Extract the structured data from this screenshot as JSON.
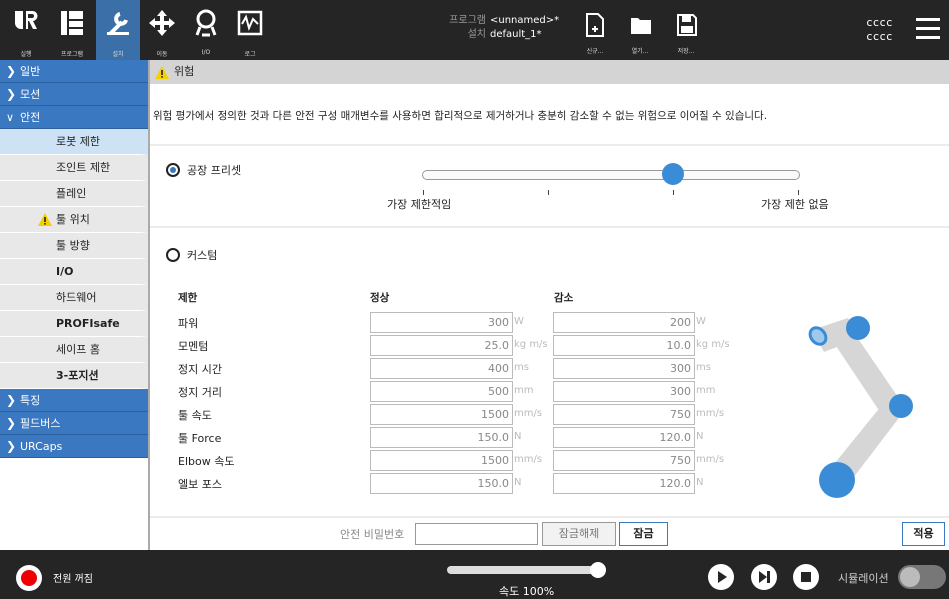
{
  "topbar": {
    "nav": [
      {
        "label": "실행",
        "icon": "ur-logo-icon"
      },
      {
        "label": "프로그램",
        "icon": "program-icon"
      },
      {
        "label": "설치",
        "icon": "installation-icon"
      },
      {
        "label": "이동",
        "icon": "move-icon"
      },
      {
        "label": "I/O",
        "icon": "io-icon"
      },
      {
        "label": "로그",
        "icon": "log-icon"
      }
    ],
    "program_key": "프로그램",
    "program_value": "<unnamed>*",
    "install_key": "설치",
    "install_value": "default_1*",
    "file_buttons": [
      {
        "label": "신규...",
        "icon": "new-file-icon"
      },
      {
        "label": "열기...",
        "icon": "open-folder-icon"
      },
      {
        "label": "저장...",
        "icon": "save-icon"
      }
    ],
    "user_line1": "cccc",
    "user_line2": "cccc",
    "menu_icon": "hamburger-menu-icon"
  },
  "sidebar": {
    "groups": [
      {
        "label": "일반",
        "expanded": false
      },
      {
        "label": "모션",
        "expanded": false
      },
      {
        "label": "안전",
        "expanded": true
      }
    ],
    "safety_items": [
      {
        "label": "로봇 제한",
        "selected": true,
        "bold": false,
        "warning": false
      },
      {
        "label": "조인트 제한",
        "selected": false,
        "bold": false,
        "warning": false
      },
      {
        "label": "플레인",
        "selected": false,
        "bold": false,
        "warning": false
      },
      {
        "label": "툴 위치",
        "selected": false,
        "bold": false,
        "warning": true
      },
      {
        "label": "툴 방향",
        "selected": false,
        "bold": false,
        "warning": false
      },
      {
        "label": "I/O",
        "selected": false,
        "bold": true,
        "warning": false
      },
      {
        "label": "하드웨어",
        "selected": false,
        "bold": false,
        "warning": false
      },
      {
        "label": "PROFIsafe",
        "selected": false,
        "bold": true,
        "warning": false
      },
      {
        "label": "세이프 홈",
        "selected": false,
        "bold": false,
        "warning": false
      },
      {
        "label": "3-포지션",
        "selected": false,
        "bold": true,
        "warning": false
      }
    ],
    "groups_after": [
      {
        "label": "특징"
      },
      {
        "label": "필드버스"
      },
      {
        "label": "URCaps"
      }
    ]
  },
  "main": {
    "header": "위험",
    "description": "위험 평가에서 정의한 것과 다른 안전 구성 매개변수를 사용하면 합리적으로 제거하거나 충분히 감소할 수 없는 위험으로 이어질 수 있습니다.",
    "preset_label": "공장 프리셋",
    "preset_selected": true,
    "slider_level_fraction": 0.66,
    "slider_min_label": "가장 제한적임",
    "slider_max_label": "가장 제한 없음",
    "custom_label": "커스텀",
    "custom_selected": false,
    "col_limit": "제한",
    "col_normal": "정상",
    "col_reduced": "감소",
    "rows": [
      {
        "label": "파워",
        "normal": "300",
        "normal_unit": "W",
        "reduced": "200",
        "reduced_unit": "W"
      },
      {
        "label": "모멘텀",
        "normal": "25.0",
        "normal_unit": "kg m/s",
        "reduced": "10.0",
        "reduced_unit": "kg m/s"
      },
      {
        "label": "정지 시간",
        "normal": "400",
        "normal_unit": "ms",
        "reduced": "300",
        "reduced_unit": "ms"
      },
      {
        "label": "정지 거리",
        "normal": "500",
        "normal_unit": "mm",
        "reduced": "300",
        "reduced_unit": "mm"
      },
      {
        "label": "툴 속도",
        "normal": "1500",
        "normal_unit": "mm/s",
        "reduced": "750",
        "reduced_unit": "mm/s"
      },
      {
        "label": "툴 Force",
        "normal": "150.0",
        "normal_unit": "N",
        "reduced": "120.0",
        "reduced_unit": "N"
      },
      {
        "label": "Elbow 속도",
        "normal": "1500",
        "normal_unit": "mm/s",
        "reduced": "750",
        "reduced_unit": "mm/s"
      },
      {
        "label": "엘보 포스",
        "normal": "150.0",
        "normal_unit": "N",
        "reduced": "120.0",
        "reduced_unit": "N"
      }
    ],
    "password_label": "안전 비밀번호",
    "password_value": "",
    "unlock_label": "잠금해제",
    "lock_label": "잠금",
    "apply_label": "적용"
  },
  "footer": {
    "power_label": "전원 꺼짐",
    "speed_label": "속도 100%",
    "speed_fraction": 1.0,
    "play_icon": "play-icon",
    "step_icon": "step-icon",
    "stop_icon": "stop-icon",
    "sim_label": "시뮬레이션",
    "sim_on": false
  },
  "colors": {
    "accent": "#3b78c2",
    "topbar": "#252525",
    "selected": "#cde3f5",
    "warning": "#f5d000"
  }
}
